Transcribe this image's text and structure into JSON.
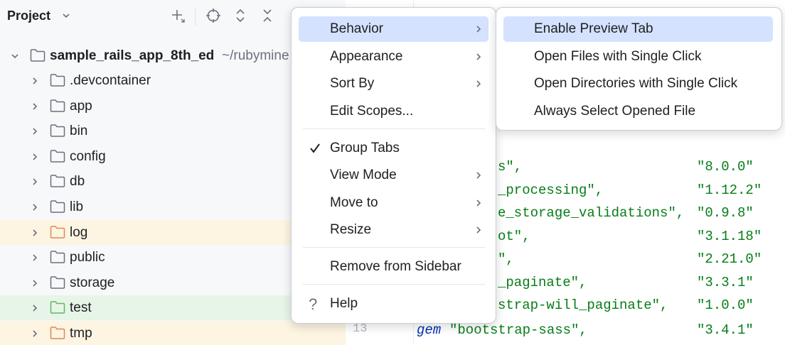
{
  "project_panel": {
    "title": "Project",
    "toolbar_icons": [
      "add-icon",
      "locate-icon",
      "expand-all-icon",
      "collapse-all-icon"
    ],
    "root": {
      "name": "sample_rails_app_8th_ed",
      "path": "~/rubymine"
    },
    "items": [
      {
        "label": ".devcontainer",
        "highlight": "none"
      },
      {
        "label": "app",
        "highlight": "none"
      },
      {
        "label": "bin",
        "highlight": "none"
      },
      {
        "label": "config",
        "highlight": "none"
      },
      {
        "label": "db",
        "highlight": "none"
      },
      {
        "label": "lib",
        "highlight": "none"
      },
      {
        "label": "log",
        "highlight": "yellow"
      },
      {
        "label": "public",
        "highlight": "none"
      },
      {
        "label": "storage",
        "highlight": "none"
      },
      {
        "label": "test",
        "highlight": "green"
      },
      {
        "label": "tmp",
        "highlight": "yellow"
      }
    ]
  },
  "editor": {
    "lines": [
      {
        "name": "s\",",
        "version": "\"8.0.0\""
      },
      {
        "name": "_processing\",",
        "version": "\"1.12.2\""
      },
      {
        "name": "e_storage_validations\",",
        "version": "\"0.9.8\""
      },
      {
        "name": "ot\",",
        "version": "\"3.1.18\""
      },
      {
        "name": "\",",
        "version": "\"2.21.0\""
      },
      {
        "name": "_paginate\",",
        "version": "\"3.3.1\""
      },
      {
        "name": "strap-will_paginate\",",
        "version": "\"1.0.0\""
      }
    ],
    "last_line": {
      "number": "13",
      "keyword": "gem",
      "name": "\"bootstrap-sass\",",
      "version": "\"3.4.1\""
    }
  },
  "context_menu": {
    "items": [
      {
        "label": "Behavior",
        "submenu": true,
        "active": true
      },
      {
        "label": "Appearance",
        "submenu": true
      },
      {
        "label": "Sort By",
        "submenu": true
      },
      {
        "label": "Edit Scopes...",
        "submenu": false
      },
      {
        "label": "Group Tabs",
        "submenu": false,
        "checked": true
      },
      {
        "label": "View Mode",
        "submenu": true
      },
      {
        "label": "Move to",
        "submenu": true
      },
      {
        "label": "Resize",
        "submenu": true
      },
      {
        "label": "Remove from Sidebar",
        "submenu": false
      },
      {
        "label": "Help",
        "submenu": false,
        "icon": "help-icon"
      }
    ]
  },
  "submenu": {
    "items": [
      {
        "label": "Enable Preview Tab",
        "active": true
      },
      {
        "label": "Open Files with Single Click"
      },
      {
        "label": "Open Directories with Single Click"
      },
      {
        "label": "Always Select Opened File"
      }
    ]
  },
  "colors": {
    "accent_selection": "#d4e2ff",
    "string_green": "#067d17",
    "keyword_blue": "#0033b3",
    "folder_yellow_highlight": "#fdf4e2",
    "folder_green_highlight": "#e7f5e8",
    "folder_orange": "#e08855",
    "folder_green": "#5fb865"
  }
}
